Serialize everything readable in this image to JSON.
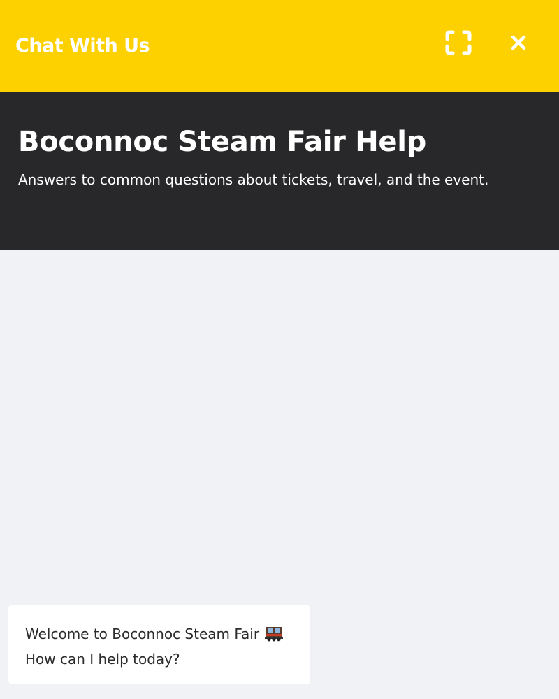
{
  "topbar": {
    "title": "Chat With Us",
    "expand_icon": "expand-icon",
    "close_icon": "close-icon",
    "color": "#fdd000"
  },
  "header": {
    "title": "Boconnoc Steam Fair Help",
    "subtitle": "Answers to common questions about tickets, travel, and the event.",
    "color": "#28282b"
  },
  "messages": [
    {
      "text_before": "Welcome to Boconnoc Steam Fair",
      "icon": "steam-train-icon",
      "text_after": "How can I help today?"
    }
  ],
  "colors": {
    "background": "#f1f2f6",
    "bubble": "#ffffff"
  }
}
